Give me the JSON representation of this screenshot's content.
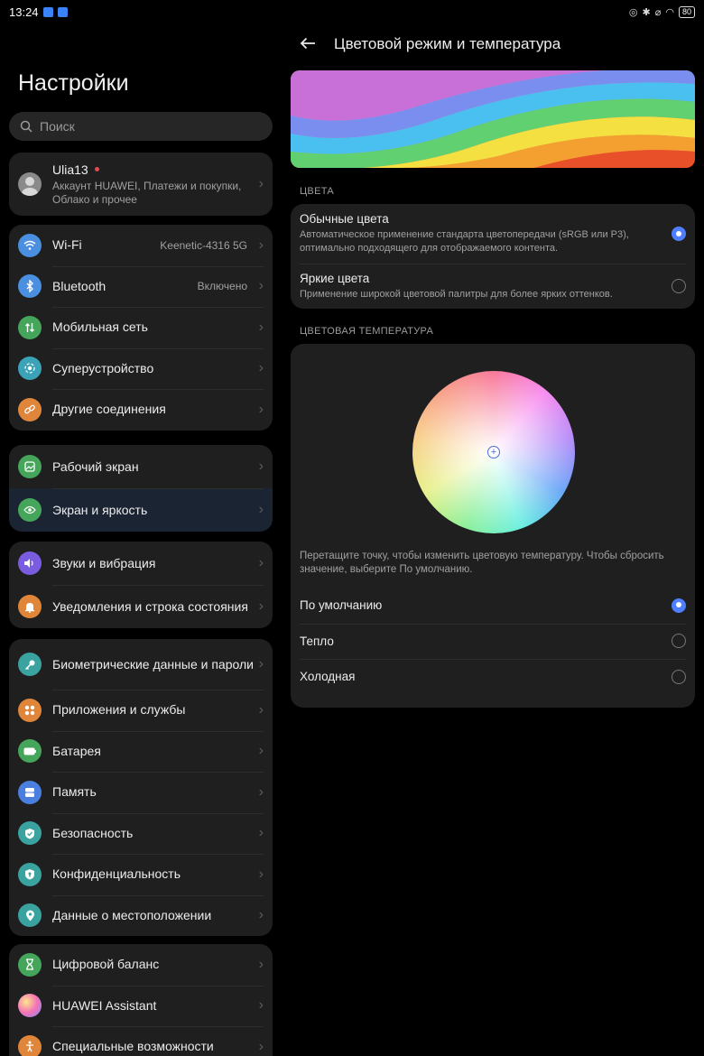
{
  "status_bar": {
    "time": "13:24",
    "battery": "80"
  },
  "left": {
    "title": "Настройки",
    "search_placeholder": "Поиск",
    "profile": {
      "name": "Ulia13",
      "subtitle_line1": "Аккаунт HUAWEI, Платежи и покупки,",
      "subtitle_line2": "Облако и прочее"
    },
    "groups": [
      [
        {
          "label": "Wi-Fi",
          "value": "Keenetic-4316 5G",
          "icon": "wifi-icon",
          "color": "#4a8fe0"
        },
        {
          "label": "Bluetooth",
          "value": "Включено",
          "icon": "bluetooth-icon",
          "color": "#4a8fe0"
        },
        {
          "label": "Мобильная сеть",
          "value": "",
          "icon": "mobile-network-icon",
          "color": "#45a55a"
        },
        {
          "label": "Суперустройство",
          "value": "",
          "icon": "super-device-icon",
          "color": "#3aa3b8"
        },
        {
          "label": "Другие соединения",
          "value": "",
          "icon": "link-icon",
          "color": "#e0863a"
        }
      ],
      [
        {
          "label": "Рабочий экран",
          "value": "",
          "icon": "home-screen-icon",
          "color": "#45a55a"
        },
        {
          "label": "Экран и яркость",
          "value": "",
          "icon": "eye-icon",
          "color": "#45a55a"
        }
      ],
      [
        {
          "label": "Звуки и вибрация",
          "value": "",
          "icon": "speaker-icon",
          "color": "#7a5ce0"
        },
        {
          "label": "Уведомления и строка состояния",
          "value": "",
          "icon": "bell-icon",
          "color": "#e0863a"
        }
      ],
      [
        {
          "label": "Биометрические данные и пароли",
          "value": "",
          "icon": "key-icon",
          "color": "#3aa3a0"
        },
        {
          "label": "Приложения и службы",
          "value": "",
          "icon": "apps-icon",
          "color": "#e0863a"
        },
        {
          "label": "Батарея",
          "value": "",
          "icon": "battery-icon",
          "color": "#45a55a"
        },
        {
          "label": "Память",
          "value": "",
          "icon": "storage-icon",
          "color": "#4a7fe0"
        },
        {
          "label": "Безопасность",
          "value": "",
          "icon": "shield-icon",
          "color": "#3aa3a0"
        },
        {
          "label": "Конфиденциальность",
          "value": "",
          "icon": "privacy-icon",
          "color": "#3aa3a0"
        },
        {
          "label": "Данные о местоположении",
          "value": "",
          "icon": "location-icon",
          "color": "#3aa3a0"
        }
      ],
      [
        {
          "label": "Цифровой баланс",
          "value": "",
          "icon": "hourglass-icon",
          "color": "#45a55a"
        },
        {
          "label": "HUAWEI Assistant",
          "value": "",
          "icon": "assistant-icon",
          "color": "#c86ad8"
        },
        {
          "label": "Специальные возможности",
          "value": "",
          "icon": "accessibility-icon",
          "color": "#e0863a"
        }
      ]
    ]
  },
  "right": {
    "title": "Цветовой режим и температура",
    "colors_section": "ЦВЕТА",
    "color_options": [
      {
        "title": "Обычные цвета",
        "desc": "Автоматическое применение стандарта цветопередачи (sRGB или P3), оптимально подходящего для отображаемого контента.",
        "selected": true
      },
      {
        "title": "Яркие цвета",
        "desc": "Применение широкой цветовой палитры для более ярких оттенков.",
        "selected": false
      }
    ],
    "temp_section": "ЦВЕТОВАЯ ТЕМПЕРАТУРА",
    "temp_hint": "Перетащите точку, чтобы изменить цветовую температуру. Чтобы сбросить значение, выберите По умолчанию.",
    "temp_options": [
      {
        "title": "По умолчанию",
        "selected": true
      },
      {
        "title": "Тепло",
        "selected": false
      },
      {
        "title": "Холодная",
        "selected": false
      }
    ]
  },
  "colors": {
    "accent": "#4f7fff",
    "selected_row": "#1b2433"
  }
}
